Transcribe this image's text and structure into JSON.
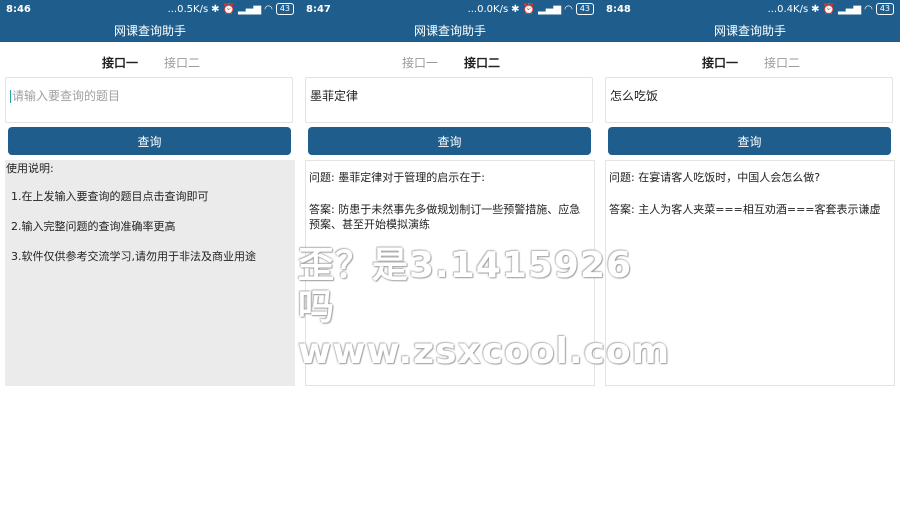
{
  "colors": {
    "primary": "#1f5e8c",
    "result_bg_gray": "#ebebeb"
  },
  "app_title": "网课查询助手",
  "panels": [
    {
      "status": {
        "time": "8:46",
        "speed": "...0.5K/s",
        "battery": "43"
      },
      "tabs": [
        "接口一",
        "接口二"
      ],
      "active_tab": 0,
      "input": {
        "value": "",
        "placeholder": "请输入要查询的题目"
      },
      "button_label": "查询",
      "result": {
        "title": "使用说明:",
        "items": [
          "1.在上发输入要查询的题目点击查询即可",
          "2.输入完整问题的查询准确率更高",
          "3.软件仅供参考交流学习,请勿用于非法及商业用途"
        ]
      }
    },
    {
      "status": {
        "time": "8:47",
        "speed": "...0.0K/s",
        "battery": "43"
      },
      "tabs": [
        "接口一",
        "接口二"
      ],
      "active_tab": 1,
      "input": {
        "value": "墨菲定律",
        "placeholder": ""
      },
      "button_label": "查询",
      "result": {
        "question": "问题: 墨菲定律对于管理的启示在于:",
        "answer": "答案: 防患于未然事先多做规划制订一些预警措施、应急预案、甚至开始模拟演练"
      }
    },
    {
      "status": {
        "time": "8:48",
        "speed": "...0.4K/s",
        "battery": "43"
      },
      "tabs": [
        "接口一",
        "接口二"
      ],
      "active_tab": 0,
      "input": {
        "value": "怎么吃饭",
        "placeholder": ""
      },
      "button_label": "查询",
      "result": {
        "question": "问题: 在宴请客人吃饭时，中国人会怎么做?",
        "answer": "答案: 主人为客人夹菜===相互劝酒===客套表示谦虚"
      }
    }
  ],
  "watermark": {
    "line1": "歪？是3.1415926吗",
    "line2": "www.zsxcool.com"
  }
}
